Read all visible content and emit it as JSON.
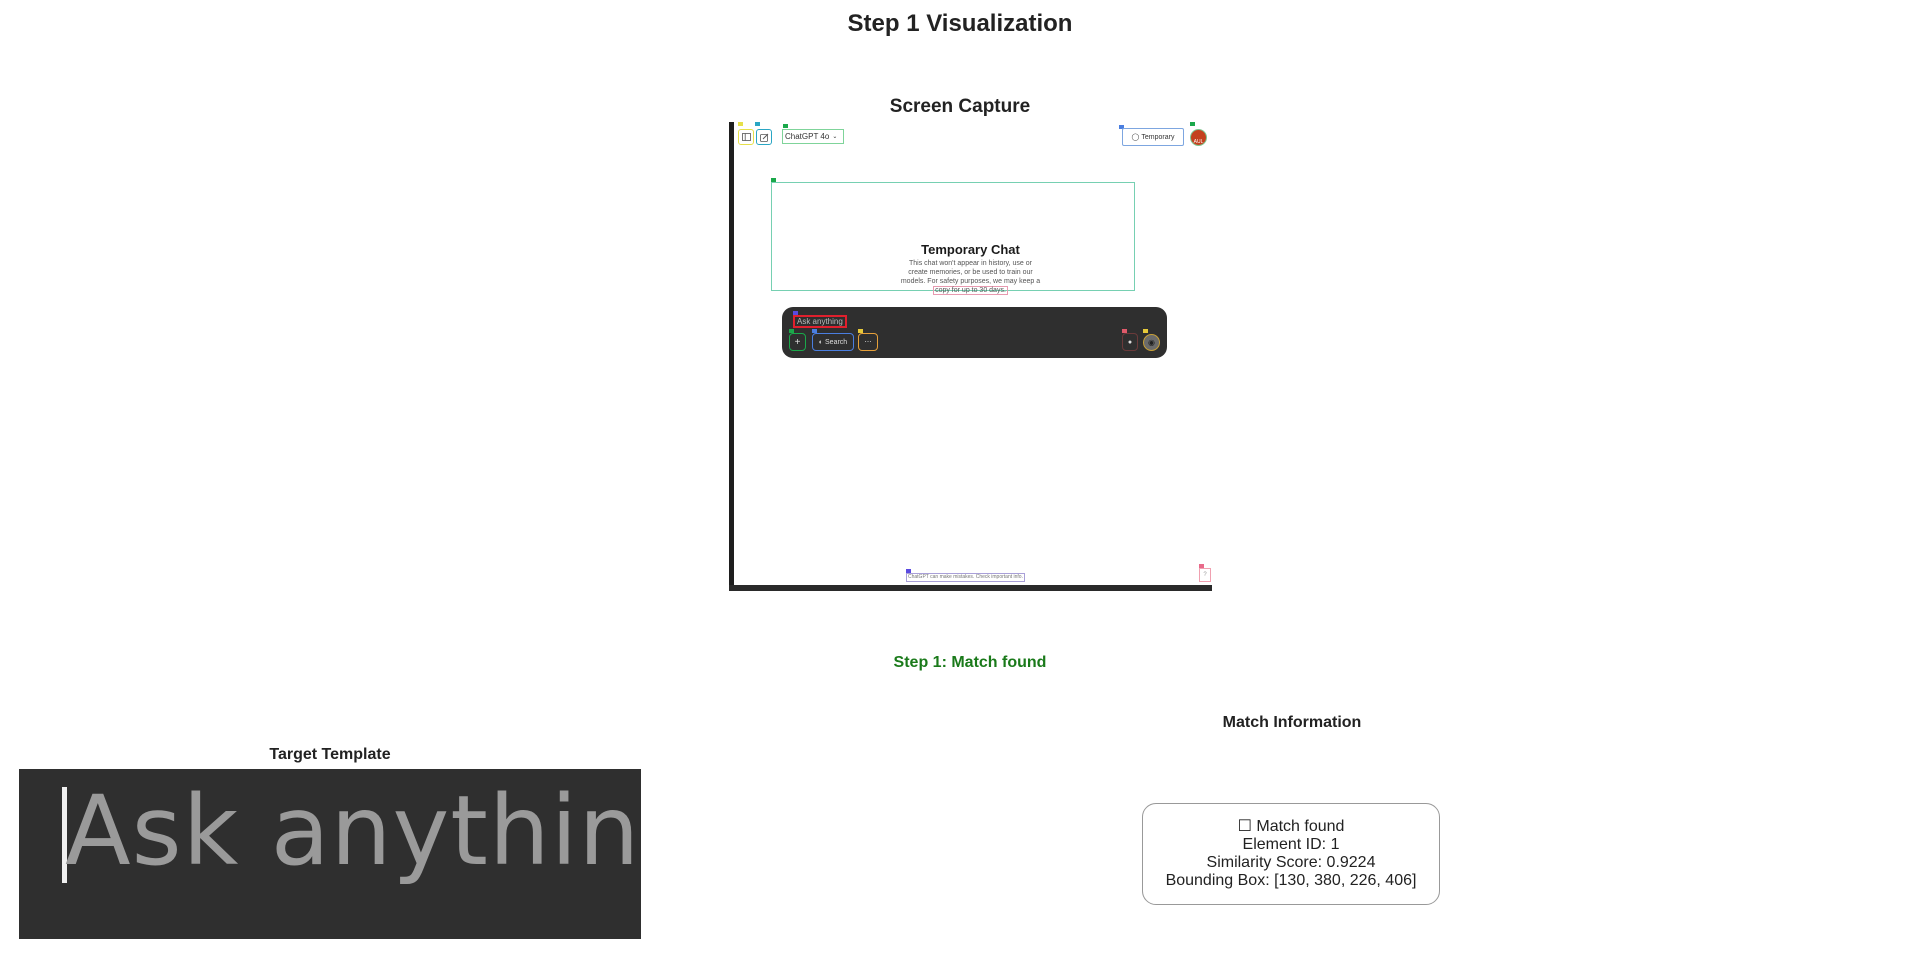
{
  "page": {
    "title": "Step 1 Visualization",
    "capture_title": "Screen Capture",
    "status": "Step 1: Match found",
    "template_title": "Target Template",
    "match_title": "Match Information"
  },
  "capture": {
    "model_selector": "ChatGPT 4o",
    "temporary_label": "Temporary",
    "avatar_initials": "AUL",
    "hero_title": "Temporary Chat",
    "hero_lines": [
      "This chat won't appear in history, use or",
      "create memories, or be used to train our",
      "models. For safety purposes, we may keep a",
      "copy for up to 30 days."
    ],
    "composer_placeholder": "Ask anything",
    "search_label": "Search",
    "footer_note": "ChatGPT can make mistakes. Check important info.",
    "help_label": "?"
  },
  "template": {
    "text": "Ask anything"
  },
  "match": {
    "line1": "Match found",
    "line2": "Element ID: 1",
    "line3": "Similarity Score: 0.9224",
    "line4": "Bounding Box: [130, 380, 226, 406]"
  },
  "colors": {
    "status": "#1a7a1a",
    "composer_bg": "#2f2f2f",
    "highlight": "#e0202d",
    "avatar": "#c4411e"
  }
}
